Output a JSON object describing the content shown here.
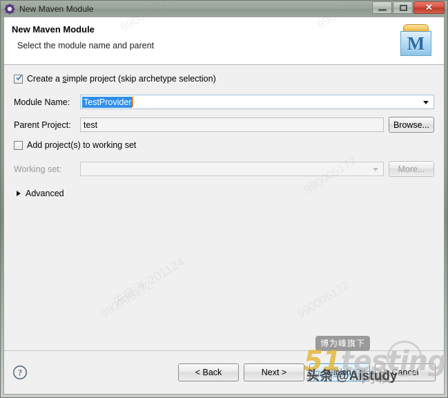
{
  "window": {
    "title": "New Maven Module",
    "icon": "gear-icon",
    "controls": {
      "minimize": "–",
      "maximize": "□",
      "close": "✕"
    }
  },
  "header": {
    "title": "New Maven Module",
    "subtitle": "Select the module name and parent",
    "banner_icon": "maven-folder-icon",
    "banner_letter": "M"
  },
  "form": {
    "simple_project": {
      "label_before": "Create a ",
      "mnemonic": "s",
      "label_after": "imple project (skip archetype selection)",
      "checked": true
    },
    "module_name": {
      "label_before": "M",
      "label_mnemonic": "M",
      "label": "Module Name:",
      "value": "TestProvider",
      "selected": true,
      "dropdown_icon": "chevron-down-icon"
    },
    "parent_project": {
      "label": "Parent Project:",
      "value": "test",
      "browse_label": "Browse..."
    },
    "working_set_checkbox": {
      "label": "Add project(s) to working set",
      "checked": false
    },
    "working_set": {
      "label": "Working set:",
      "value": "",
      "more_label": "More...",
      "disabled": true,
      "dropdown_icon": "chevron-down-icon"
    },
    "advanced": {
      "label": "Advanced",
      "expanded": false,
      "icon": "triangle-right-icon"
    }
  },
  "footer": {
    "help_icon": "help-question-icon",
    "back_label": "< Back",
    "next_label": "Next >",
    "finish_label": "Finish",
    "cancel_label": "Cancel"
  },
  "watermarks": {
    "number": "990005172",
    "number_alt": "990005172",
    "text_cn": "朱晓洲 201124",
    "badge_cn": "博为峰旗下",
    "brand_51": "51",
    "brand_testing": "testing",
    "brand_cn_left": "软件测试",
    "brand_cn_right": "网校",
    "toutiao": "头条 @Aistudy"
  },
  "colors": {
    "titlebar": "#9aa69c",
    "close_button": "#d4523f",
    "selection_blue": "#2f8fe8",
    "caret_orange": "#e08b30",
    "default_button_border": "#3c9ad4",
    "maven_blue": "#2b6ca8",
    "maven_folder": "#f6c963"
  }
}
